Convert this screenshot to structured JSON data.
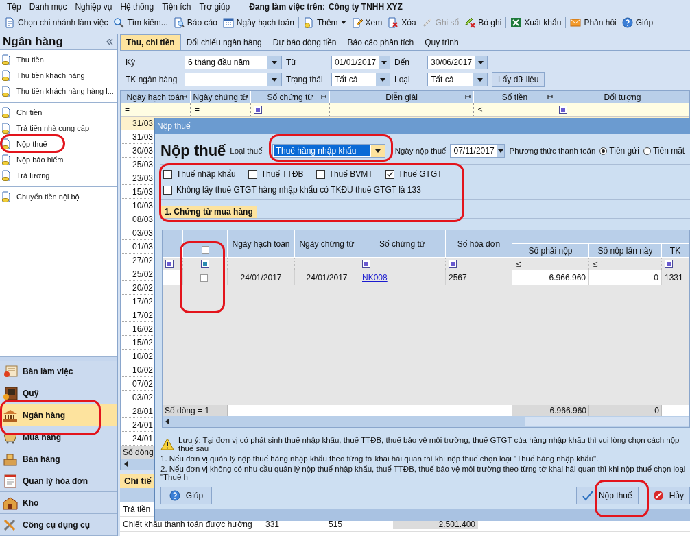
{
  "menu_bar": {
    "items": [
      "Tệp",
      "Danh mục",
      "Nghiệp vụ",
      "Hệ thống",
      "Tiện ích",
      "Trợ giúp"
    ],
    "context_label": "Đang làm việc trên:",
    "company": "Công ty TNHH XYZ"
  },
  "toolbar": {
    "groups": [
      {
        "items": [
          {
            "label": "Chọn chi nhánh làm việc",
            "disabled": false,
            "dropdown": false
          },
          {
            "label": "Tìm kiếm...",
            "disabled": false,
            "dropdown": false
          },
          {
            "label": "Báo cáo",
            "disabled": false,
            "dropdown": false
          },
          {
            "label": "Ngày hạch toán",
            "disabled": false,
            "dropdown": false
          }
        ]
      },
      {
        "items": [
          {
            "label": "Thêm",
            "disabled": false,
            "dropdown": true
          },
          {
            "label": "Xem",
            "disabled": false,
            "dropdown": false
          },
          {
            "label": "Xóa",
            "disabled": false,
            "dropdown": false
          },
          {
            "label": "Ghi sổ",
            "disabled": true,
            "dropdown": false
          },
          {
            "label": "Bỏ ghi",
            "disabled": false,
            "dropdown": false
          }
        ]
      },
      {
        "items": [
          {
            "label": "Xuất khẩu",
            "disabled": false,
            "dropdown": false
          }
        ]
      },
      {
        "items": [
          {
            "label": "Phản hồi",
            "disabled": false,
            "dropdown": false
          },
          {
            "label": "Giúp",
            "disabled": false,
            "dropdown": false
          }
        ]
      }
    ]
  },
  "sidebar": {
    "title": "Ngân hàng",
    "groups": [
      {
        "items": [
          "Thu tiền",
          "Thu tiền khách hàng",
          "Thu tiền khách hàng hàng l..."
        ]
      },
      {
        "items": [
          "Chi tiền",
          "Trả tiền nhà cung cấp",
          "Nộp thuế",
          "Nộp bảo hiểm",
          "Trả lương"
        ]
      },
      {
        "items": [
          "Chuyển tiền nội bộ"
        ]
      }
    ],
    "modules": [
      {
        "label": "Bàn làm việc",
        "selected": false
      },
      {
        "label": "Quỹ",
        "selected": false
      },
      {
        "label": "Ngân hàng",
        "selected": true
      },
      {
        "label": "Mua hàng",
        "selected": false
      },
      {
        "label": "Bán hàng",
        "selected": false
      },
      {
        "label": "Quản lý hóa đơn",
        "selected": false
      },
      {
        "label": "Kho",
        "selected": false
      },
      {
        "label": "Công cụ dụng cụ",
        "selected": false
      }
    ]
  },
  "main": {
    "tabs": [
      {
        "label": "Thu, chi tiền",
        "selected": true
      },
      {
        "label": "Đối chiếu ngân hàng",
        "selected": false
      },
      {
        "label": "Dự báo dòng tiền",
        "selected": false
      },
      {
        "label": "Báo cáo phân tích",
        "selected": false
      },
      {
        "label": "Quy trình",
        "selected": false
      }
    ],
    "filters": {
      "period": {
        "label": "Kỳ",
        "value": "6 tháng đầu năm"
      },
      "from": {
        "label": "Từ",
        "value": "01/01/2017"
      },
      "to": {
        "label": "Đến",
        "value": "30/06/2017"
      },
      "bank_account": {
        "label": "TK ngân hàng"
      },
      "status": {
        "label": "Trạng thái",
        "value": "Tất cả"
      },
      "type": {
        "label": "Loại",
        "value": "Tất cả"
      },
      "fetch_button": "Lấy dữ liệu"
    },
    "grid": {
      "columns": [
        {
          "label": "Ngày hạch toán",
          "pinned": true,
          "filter": {
            "kind": "operator",
            "text": "="
          }
        },
        {
          "label": "Ngày chứng từ",
          "pinned": true,
          "filter": {
            "kind": "operator",
            "text": "="
          }
        },
        {
          "label": "Số chứng từ",
          "pinned": true,
          "filter": {
            "kind": "box"
          }
        },
        {
          "label": "Diễn giải",
          "pinned": true
        },
        {
          "label": "Số tiền",
          "pinned": true,
          "filter": {
            "kind": "operator",
            "text": "≤"
          }
        },
        {
          "label": "Đối tượng",
          "pinned": false,
          "filter": {
            "kind": "box"
          }
        }
      ],
      "rows": [
        {
          "date": "31/03",
          "selected": true
        },
        {
          "date": "31/03",
          "selected": false
        },
        {
          "date": "30/03",
          "selected": false
        },
        {
          "date": "25/03",
          "selected": false
        },
        {
          "date": "23/03",
          "selected": false
        },
        {
          "date": "15/03",
          "selected": false
        },
        {
          "date": "10/03",
          "selected": false
        },
        {
          "date": "08/03",
          "selected": false
        },
        {
          "date": "03/03",
          "selected": false
        },
        {
          "date": "01/03",
          "selected": false
        },
        {
          "date": "27/02",
          "selected": false
        },
        {
          "date": "25/02",
          "selected": false
        },
        {
          "date": "20/02",
          "selected": false
        },
        {
          "date": "17/02",
          "selected": false
        },
        {
          "date": "17/02",
          "selected": false
        },
        {
          "date": "16/02",
          "selected": false
        },
        {
          "date": "15/02",
          "selected": false
        },
        {
          "date": "10/02",
          "selected": false
        },
        {
          "date": "10/02",
          "selected": false
        },
        {
          "date": "07/02",
          "selected": false
        },
        {
          "date": "03/02",
          "selected": false
        },
        {
          "date": "28/01",
          "selected": false
        },
        {
          "date": "24/01",
          "selected": false
        },
        {
          "date": "24/01",
          "selected": false
        }
      ],
      "footer_label": "Số dòng"
    },
    "detail": {
      "tab": "Chi tiế",
      "rows": [
        {
          "cells": [
            "Trả tiền"
          ]
        },
        {
          "cells": [
            "Chiết khấu thanh toán được hưởng",
            "331",
            "515",
            "2.501.400"
          ]
        }
      ]
    }
  },
  "dialog": {
    "title": "Nộp thuế",
    "heading": "Nộp thuế",
    "tax_type": {
      "label": "Loại thuế",
      "value": "Thuế hàng nhập khẩu",
      "focused": true
    },
    "payment_date": {
      "label": "Ngày nộp thuế",
      "value": "07/11/2017"
    },
    "payment_method": {
      "label": "Phương thức thanh toán",
      "options": [
        {
          "label": "Tiền gửi",
          "selected": true
        },
        {
          "label": "Tiền mặt",
          "selected": false
        }
      ]
    },
    "tax_checkboxes": [
      {
        "label": "Thuế nhập khẩu",
        "checked": false
      },
      {
        "label": "Thuế TTĐB",
        "checked": false
      },
      {
        "label": "Thuế BVMT",
        "checked": false
      },
      {
        "label": "Thuế GTGT",
        "checked": true
      }
    ],
    "exclude_option": {
      "label": "Không lấy thuế GTGT hàng nhập khẩu có TKĐU thuế GTGT là 133",
      "checked": false
    },
    "section_tab": "1. Chứng từ mua hàng",
    "grid": {
      "select_all_checked": false,
      "columns": [
        {
          "label": "Ngày hạch toán",
          "kind": "date",
          "grouped": false,
          "filter": {
            "kind": "operator",
            "text": "="
          }
        },
        {
          "label": "Ngày chứng từ",
          "kind": "date",
          "grouped": false,
          "filter": {
            "kind": "operator",
            "text": "="
          }
        },
        {
          "label": "Số chứng từ",
          "kind": "link",
          "grouped": false,
          "filter": {
            "kind": "box"
          }
        },
        {
          "label": "Số hóa đơn",
          "kind": "text",
          "grouped": false,
          "filter": {
            "kind": "box"
          }
        },
        {
          "label": "Số phải nộp",
          "kind": "amount",
          "grouped": true,
          "filter": {
            "kind": "operator",
            "text": "≤"
          }
        },
        {
          "label": "Số nộp lần này",
          "kind": "amount",
          "grouped": true,
          "filter": {
            "kind": "operator",
            "text": "≤"
          }
        },
        {
          "label": "TK",
          "kind": "text",
          "grouped": true,
          "filter": {
            "kind": "box"
          }
        }
      ],
      "rows": [
        {
          "checked": false,
          "cells": [
            "24/01/2017",
            "24/01/2017",
            "NK008",
            "2567",
            "6.966.960",
            "0",
            "1331"
          ]
        }
      ],
      "footer": {
        "row_count": "Số dòng = 1",
        "totals": [
          "6.966.960",
          "0"
        ]
      }
    },
    "notes": [
      "Lưu ý: Tại đơn vị có phát sinh thuế nhập khẩu, thuế TTĐB, thuế bảo vệ môi trường, thuế GTGT của hàng nhập khẩu thì vui lòng chọn cách nộp thuế sau",
      "1. Nếu đơn vị quản lý nộp thuế hàng nhập khẩu theo từng tờ khai hải quan thì khi nộp thuế chọn loại \"Thuế hàng nhập khẩu\".",
      "2. Nếu đơn vị không có nhu cầu quản lý nộp thuế nhập khẩu, thuế TTĐB, thuế bảo vệ môi trường theo từng tờ khai hải quan thì khi nộp thuế chọn loại \"Thuế h"
    ],
    "buttons": [
      {
        "label": "Giúp",
        "kind": "help"
      },
      {
        "label": "Nộp thuế",
        "kind": "confirm"
      },
      {
        "label": "Hủy",
        "kind": "cancel"
      }
    ]
  }
}
